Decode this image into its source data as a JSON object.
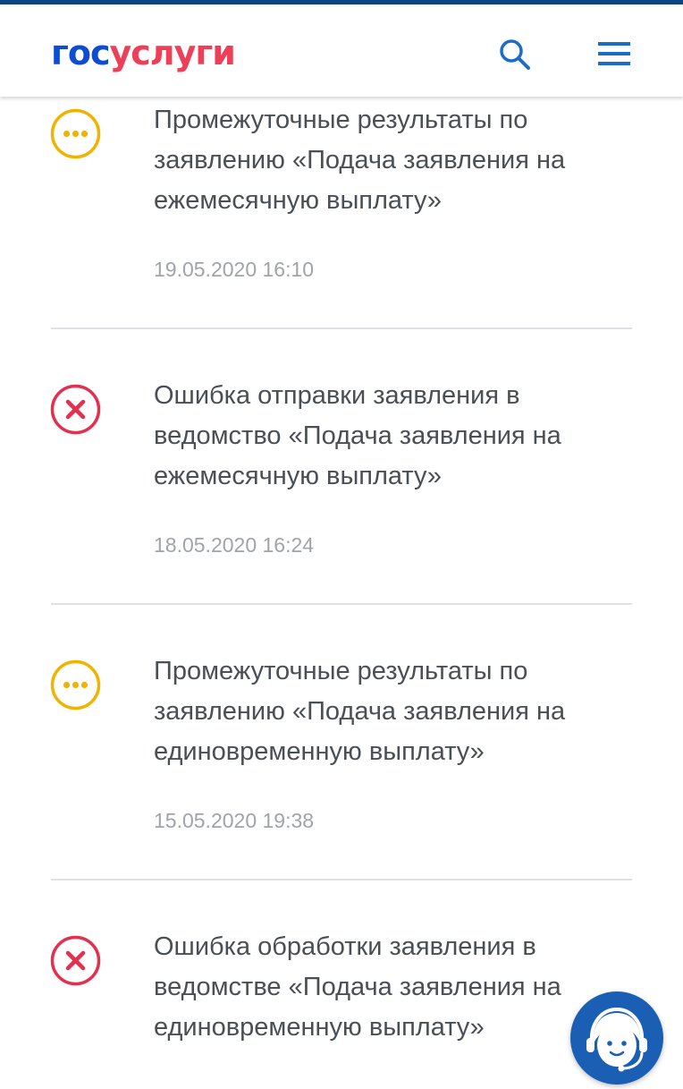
{
  "header": {
    "logo_part1": "гос",
    "logo_part2": "услуги",
    "search_icon": "search-icon",
    "menu_icon": "hamburger-menu-icon"
  },
  "notifications": [
    {
      "status": "in-progress",
      "icon": "ellipsis-circle-icon",
      "color": "#f0b400",
      "title": "Промежуточные результаты по заявлению «Подача заявления на ежемесячную выплату»",
      "date": "19.05.2020 16:10"
    },
    {
      "status": "error",
      "icon": "error-x-circle-icon",
      "color": "#e3304f",
      "title": "Ошибка отправки заявления в ведомство «Подача заявления на ежемесячную выплату»",
      "date": "18.05.2020 16:24"
    },
    {
      "status": "in-progress",
      "icon": "ellipsis-circle-icon",
      "color": "#f0b400",
      "title": "Промежуточные результаты по заявлению «Подача заявления на единовременную выплату»",
      "date": "15.05.2020 19:38"
    },
    {
      "status": "error",
      "icon": "error-x-circle-icon",
      "color": "#e3304f",
      "title": "Ошибка обработки заявления в ведомстве «Подача заявления на единовременную выплату»",
      "date": ""
    }
  ],
  "support": {
    "icon": "support-operator-icon"
  },
  "colors": {
    "accent_blue": "#0d4cd3",
    "accent_red": "#ee3f58",
    "topbar": "#0d4582",
    "text": "#4a4f55",
    "muted": "#a0a4a9",
    "icon_blue": "#1a6ec8"
  }
}
